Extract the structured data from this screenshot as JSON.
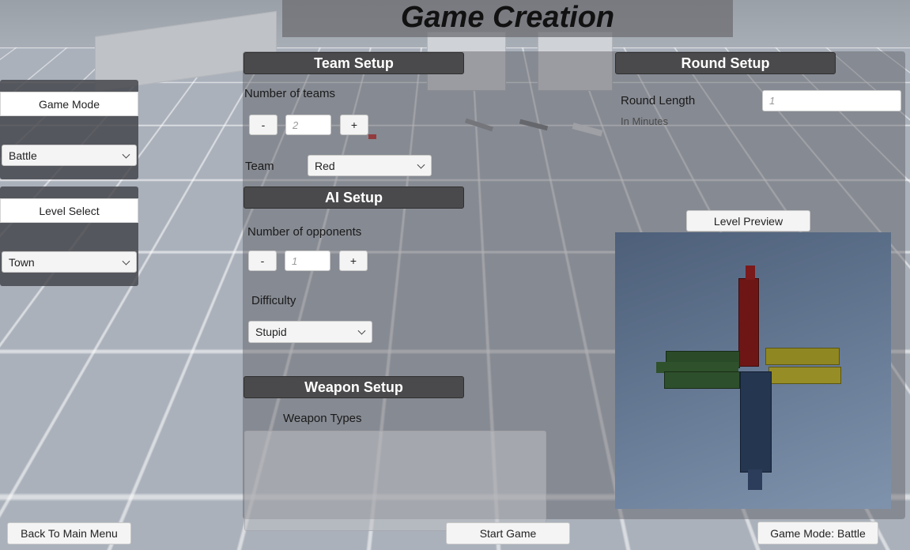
{
  "title": "Game Creation",
  "sidebar": {
    "game_mode": {
      "label": "Game Mode",
      "selected": "Battle"
    },
    "level_select": {
      "label": "Level Select",
      "selected": "Town"
    }
  },
  "team_setup": {
    "header": "Team Setup",
    "number_of_teams_label": "Number of teams",
    "minus": "-",
    "plus": "+",
    "number_of_teams_placeholder": "2",
    "team_label": "Team",
    "team_selected": "Red"
  },
  "ai_setup": {
    "header": "AI Setup",
    "number_of_opponents_label": "Number of opponents",
    "minus": "-",
    "plus": "+",
    "number_of_opponents_placeholder": "1",
    "difficulty_label": "Difficulty",
    "difficulty_selected": "Stupid"
  },
  "weapon_setup": {
    "header": "Weapon Setup",
    "weapon_types_label": "Weapon Types"
  },
  "round_setup": {
    "header": "Round Setup",
    "round_length_label": "Round Length",
    "round_length_placeholder": "1",
    "in_minutes_label": "In Minutes"
  },
  "level_preview": {
    "label": "Level Preview"
  },
  "bottom": {
    "back_label": "Back To Main Menu",
    "start_label": "Start Game",
    "mode_label": "Game Mode: Battle"
  },
  "colors": {
    "team_red": "#7a1a1a",
    "team_green": "#2c4a2c",
    "team_yellow": "#a39a2a",
    "team_blue": "#2b3a55",
    "header_bg": "#4a4a4c"
  },
  "icons": [
    "chevron-down-icon"
  ]
}
